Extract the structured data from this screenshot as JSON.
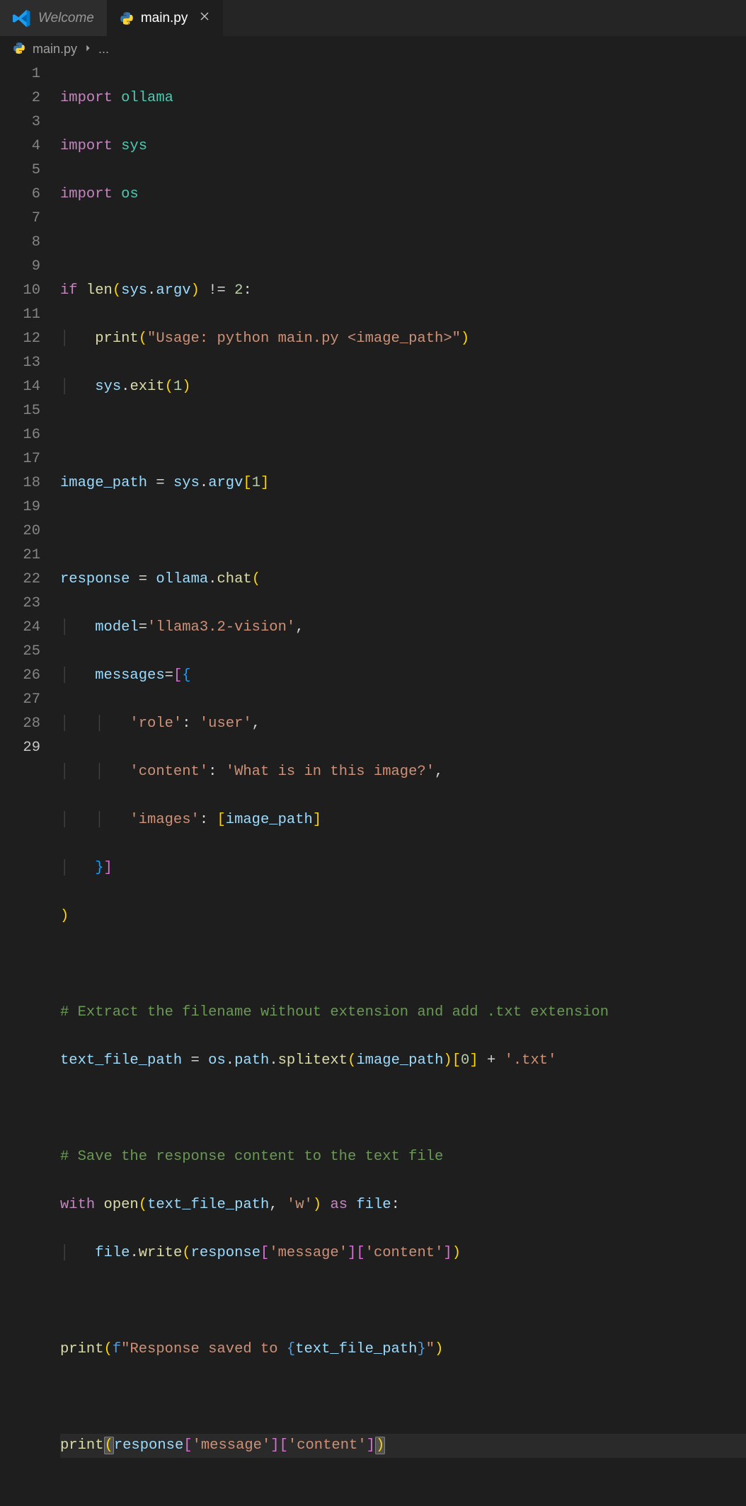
{
  "tabs": {
    "welcome": "Welcome",
    "main": "main.py"
  },
  "breadcrumb": {
    "file": "main.py",
    "more": "..."
  },
  "gutter": {
    "start": 1,
    "end": 29,
    "current": 29
  },
  "code": {
    "l1": {
      "kw": "import",
      "sp": " ",
      "mod": "ollama"
    },
    "l2": {
      "kw": "import",
      "sp": " ",
      "mod": "sys"
    },
    "l3": {
      "kw": "import",
      "sp": " ",
      "mod": "os"
    },
    "l5": {
      "kw": "if",
      "sp": " ",
      "fn": "len",
      "p1": "(",
      "v1": "sys",
      "d": ".",
      "v2": "argv",
      "p2": ")",
      "sp2": " ",
      "op": "!=",
      "sp3": " ",
      "n": "2",
      "c": ":"
    },
    "l6": {
      "fn": "print",
      "p1": "(",
      "s": "\"Usage: python main.py <image_path>\"",
      "p2": ")"
    },
    "l7": {
      "v": "sys",
      "d": ".",
      "fn": "exit",
      "p1": "(",
      "n": "1",
      "p2": ")"
    },
    "l9": {
      "v": "image_path",
      "sp": " ",
      "eq": "=",
      "sp2": " ",
      "m": "sys",
      "d": ".",
      "v2": "argv",
      "b1": "[",
      "n": "1",
      "b2": "]"
    },
    "l11": {
      "v": "response",
      "sp": " ",
      "eq": "=",
      "sp2": " ",
      "m": "ollama",
      "d": ".",
      "fn": "chat",
      "p1": "("
    },
    "l12": {
      "v": "model",
      "eq": "=",
      "s": "'llama3.2-vision'",
      "c": ","
    },
    "l13": {
      "v": "messages",
      "eq": "=",
      "b1": "[",
      "b2": "{"
    },
    "l14": {
      "k": "'role'",
      "c": ":",
      "sp": " ",
      "s": "'user'",
      "cm": ","
    },
    "l15": {
      "k": "'content'",
      "c": ":",
      "sp": " ",
      "s": "'What is in this image?'",
      "cm": ","
    },
    "l16": {
      "k": "'images'",
      "c": ":",
      "sp": " ",
      "b1": "[",
      "v": "image_path",
      "b2": "]"
    },
    "l17": {
      "b1": "}",
      "b2": "]"
    },
    "l18": {
      "p": ")"
    },
    "l20": {
      "c": "# Extract the filename without extension and add .txt extension"
    },
    "l21": {
      "v": "text_file_path",
      "sp": " ",
      "eq": "=",
      "sp2": " ",
      "m": "os",
      "d1": ".",
      "v2": "path",
      "d2": ".",
      "fn": "splitext",
      "p1": "(",
      "a": "image_path",
      "p2": ")",
      "b1": "[",
      "n": "0",
      "b2": "]",
      "sp3": " ",
      "op": "+",
      "sp4": " ",
      "s": "'.txt'"
    },
    "l23": {
      "c": "# Save the response content to the text file"
    },
    "l24": {
      "kw": "with",
      "sp": " ",
      "fn": "open",
      "p1": "(",
      "a": "text_file_path",
      "cm": ",",
      "sp2": " ",
      "s": "'w'",
      "p2": ")",
      "sp3": " ",
      "as": "as",
      "sp4": " ",
      "v": "file",
      "cl": ":"
    },
    "l25": {
      "v": "file",
      "d": ".",
      "fn": "write",
      "p1": "(",
      "a": "response",
      "b1": "[",
      "k1": "'message'",
      "b2": "]",
      "b3": "[",
      "k2": "'content'",
      "b4": "]",
      "p2": ")"
    },
    "l27": {
      "fn": "print",
      "p1": "(",
      "f": "f",
      "s1": "\"Response saved to ",
      "cb1": "{",
      "v": "text_file_path",
      "cb2": "}",
      "s2": "\"",
      "p2": ")"
    },
    "l29": {
      "fn": "print",
      "p1": "(",
      "a": "response",
      "b1": "[",
      "k1": "'message'",
      "b2": "]",
      "b3": "[",
      "k2": "'content'",
      "b4": "]",
      "p2": ")"
    }
  }
}
